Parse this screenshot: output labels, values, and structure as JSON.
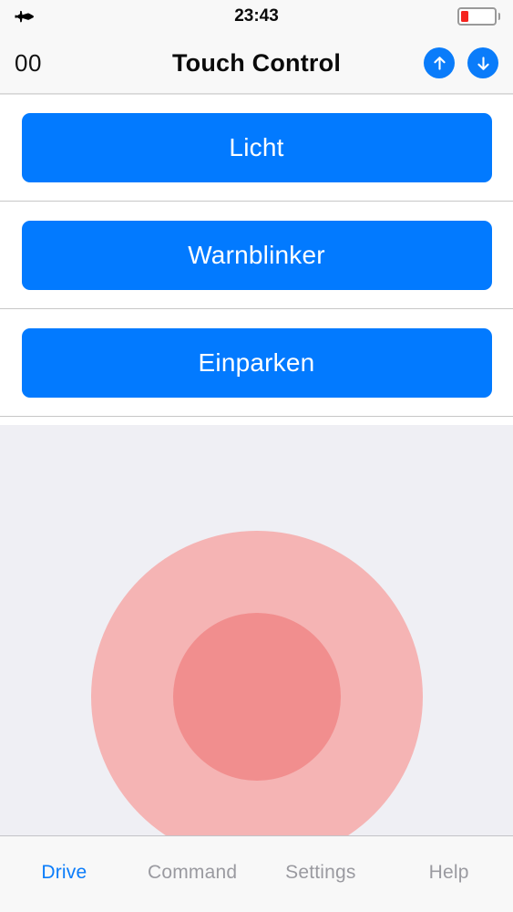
{
  "status_bar": {
    "airplane_icon": "airplane-mode-icon",
    "time": "23:43",
    "battery_icon": "battery-low-icon",
    "battery_level_percent": 20,
    "battery_color": "#F5241F"
  },
  "nav_bar": {
    "counter": "00",
    "title": "Touch Control",
    "up_button_icon": "arrow-up-icon",
    "down_button_icon": "arrow-down-icon",
    "button_color": "#0A7CFA"
  },
  "actions": [
    {
      "label": "Licht"
    },
    {
      "label": "Warnblinker"
    },
    {
      "label": "Einparken"
    }
  ],
  "action_button_color": "#027AFF",
  "touch_pad": {
    "outer_circle_color": "#F5B4B4",
    "inner_circle_color": "#F18E8E",
    "background_color": "#EFEFF4"
  },
  "tabs": [
    {
      "label": "Drive",
      "active": true
    },
    {
      "label": "Command",
      "active": false
    },
    {
      "label": "Settings",
      "active": false
    },
    {
      "label": "Help",
      "active": false
    }
  ],
  "tab_active_color": "#0A7CFA",
  "tab_inactive_color": "#9A9AA0"
}
